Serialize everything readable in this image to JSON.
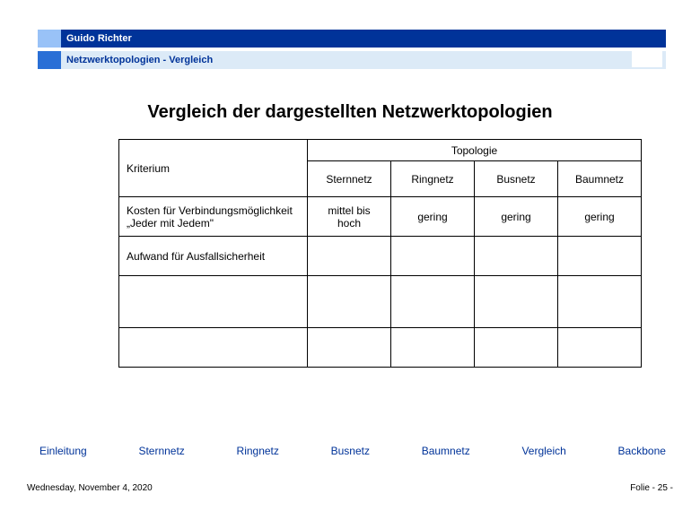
{
  "header": {
    "author": "Guido Richter",
    "subtitle": "Netzwerktopologien  - Vergleich"
  },
  "title": "Vergleich der dargestellten Netzwerktopologien",
  "table": {
    "criterion_label": "Kriterium",
    "topology_label": "Topologie",
    "columns": [
      "Sternnetz",
      "Ringnetz",
      "Busnetz",
      "Baumnetz"
    ],
    "rows": [
      {
        "label": "Kosten für Verbindungsmöglichkeit „Jeder mit Jedem\"",
        "values": [
          "mittel bis hoch",
          "gering",
          "gering",
          "gering"
        ]
      },
      {
        "label": "Aufwand für Ausfallsicherheit",
        "values": [
          "",
          "",
          "",
          ""
        ]
      },
      {
        "label": "",
        "values": [
          "",
          "",
          "",
          ""
        ]
      },
      {
        "label": "",
        "values": [
          "",
          "",
          "",
          ""
        ]
      }
    ]
  },
  "nav": {
    "items": [
      "Einleitung",
      "Sternnetz",
      "Ringnetz",
      "Busnetz",
      "Baumnetz",
      "Vergleich",
      "Backbone"
    ]
  },
  "footer": {
    "date": "Wednesday, November 4, 2020",
    "page": "Folie - 25 -"
  }
}
